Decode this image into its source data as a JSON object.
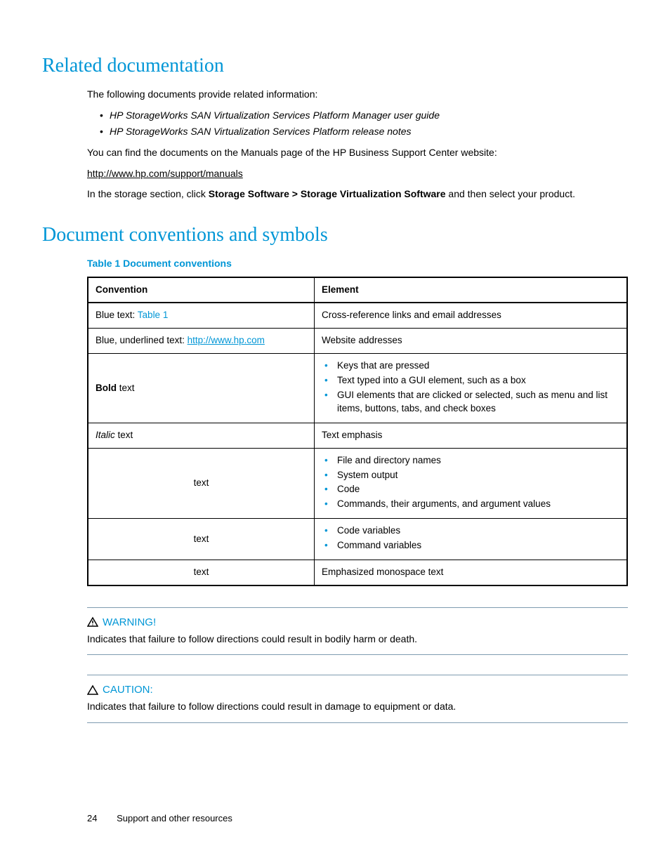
{
  "section1": {
    "title": "Related documentation",
    "intro": "The following documents provide related information:",
    "docs": [
      "HP StorageWorks SAN Virtualization Services Platform Manager user guide",
      "HP StorageWorks SAN Virtualization Services Platform release notes"
    ],
    "find": "You can find the documents on the Manuals page of the HP Business Support Center website:",
    "url": "http://www.hp.com/support/manuals",
    "storage_pre": "In the storage section, click ",
    "storage_bold": "Storage Software > Storage Virtualization Software",
    "storage_post": " and then select your product."
  },
  "section2": {
    "title": "Document conventions and symbols",
    "table_title": "Table 1 Document conventions",
    "headers": {
      "c1": "Convention",
      "c2": "Element"
    },
    "r1": {
      "pre": "Blue text: ",
      "link": "Table 1",
      "elem": "Cross-reference links and email addresses"
    },
    "r2": {
      "pre": "Blue, underlined text: ",
      "link": "http://www.hp.com",
      "elem": "Website addresses"
    },
    "r3": {
      "conv_bold": "Bold",
      "conv_post": " text",
      "items": [
        "Keys that are pressed",
        "Text typed into a GUI element, such as a box",
        "GUI elements that are clicked or selected, such as menu and list items, buttons, tabs, and check boxes"
      ]
    },
    "r4": {
      "conv_italic": "Italic",
      "conv_post": "  text",
      "elem": "Text emphasis"
    },
    "r5": {
      "conv": "text",
      "items": [
        "File and directory names",
        "System output",
        "Code",
        "Commands, their arguments, and argument values"
      ]
    },
    "r6": {
      "conv": "text",
      "items": [
        "Code variables",
        "Command variables"
      ]
    },
    "r7": {
      "conv": "text",
      "elem": "Emphasized monospace text"
    }
  },
  "warning": {
    "label": "WARNING!",
    "text": "Indicates that failure to follow directions could result in bodily harm or death."
  },
  "caution": {
    "label": "CAUTION:",
    "text": "Indicates that failure to follow directions could result in damage to equipment or data."
  },
  "footer": {
    "page": "24",
    "section": "Support and other resources"
  }
}
